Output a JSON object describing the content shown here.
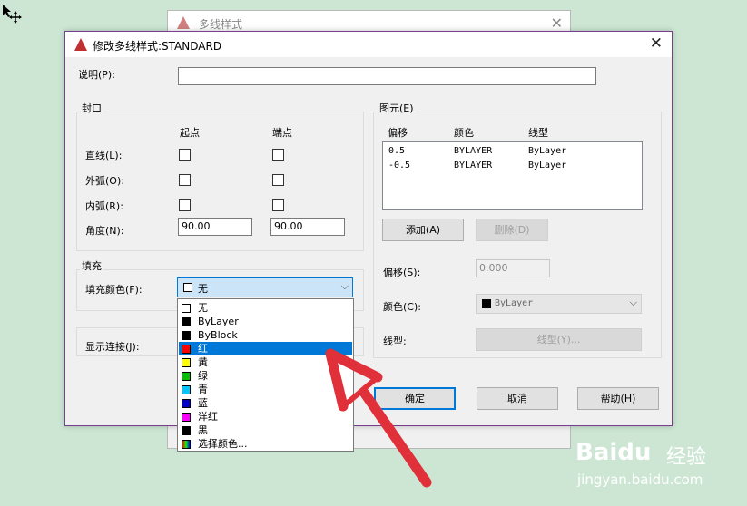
{
  "bg_dialog": {
    "title": "多线样式"
  },
  "dialog": {
    "title": "修改多线样式:STANDARD",
    "description_label": "说明(P):",
    "description_value": "",
    "caps": {
      "group": "封口",
      "start": "起点",
      "end": "端点",
      "rows": [
        "直线(L):",
        "外弧(O):",
        "内弧(R):",
        "角度(N):"
      ],
      "angle_start": "90.00",
      "angle_end": "90.00"
    },
    "fill": {
      "group": "填充",
      "color_label": "填充颜色(F):",
      "color_value": "无"
    },
    "display_joints_label": "显示连接(J):",
    "elements": {
      "group": "图元(E)",
      "headers": [
        "偏移",
        "颜色",
        "线型"
      ],
      "rows": [
        {
          "offset": "0.5",
          "color": "BYLAYER",
          "linetype": "ByLayer"
        },
        {
          "offset": "-0.5",
          "color": "BYLAYER",
          "linetype": "ByLayer"
        }
      ],
      "add_label": "添加(A)",
      "delete_label": "删除(D)",
      "offset_label": "偏移(S):",
      "offset_value": "0.000",
      "color_label": "颜色(C):",
      "color_value": "ByLayer",
      "linetype_label": "线型:",
      "linetype_button": "线型(Y)..."
    },
    "ok_label": "确定",
    "cancel_label": "取消",
    "help_label": "帮助(H)"
  },
  "dropdown": {
    "items": [
      {
        "label": "无",
        "color": "#ffffff"
      },
      {
        "label": "ByLayer",
        "color": "#000000"
      },
      {
        "label": "ByBlock",
        "color": "#000000"
      },
      {
        "label": "红",
        "color": "#ff0000",
        "selected": true
      },
      {
        "label": "黄",
        "color": "#ffff00"
      },
      {
        "label": "绿",
        "color": "#00c000"
      },
      {
        "label": "青",
        "color": "#00c8ff"
      },
      {
        "label": "蓝",
        "color": "#0000c8"
      },
      {
        "label": "洋红",
        "color": "#ff00ff"
      },
      {
        "label": "黑",
        "color": "#000000"
      },
      {
        "label": "选择颜色...",
        "color": "#40c080"
      }
    ]
  },
  "watermark": {
    "brand": "Baidu",
    "brand_cn": "经验",
    "url": "jingyan.baidu.com"
  },
  "colors": {
    "accent": "#0078d7",
    "arrow": "#e0303a",
    "desktop": "#cde6d4"
  }
}
